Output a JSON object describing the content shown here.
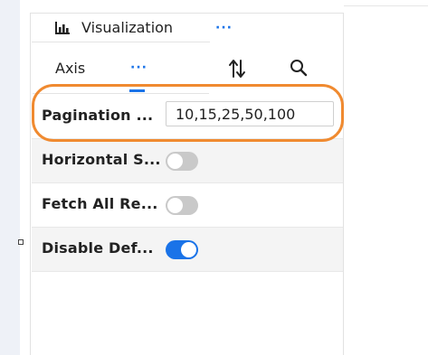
{
  "header": {
    "visualization_label": "Visualization",
    "visualization_icon": "bar-chart-icon",
    "more_label": "···"
  },
  "tabs": {
    "axis_label": "Axis",
    "more_label": "···",
    "sort_icon": "sort-arrows-icon",
    "search_icon": "search-icon",
    "accent_color": "#1a73e8"
  },
  "settings": {
    "pagination": {
      "label": "Pagination ...",
      "value": "10,15,25,50,100"
    },
    "horizontal_scroll": {
      "label": "Horizontal S...",
      "enabled": false
    },
    "fetch_all": {
      "label": "Fetch All Re...",
      "enabled": false
    },
    "disable_default": {
      "label": "Disable Def...",
      "enabled": true
    }
  },
  "annotation": {
    "color": "#f08a30"
  }
}
